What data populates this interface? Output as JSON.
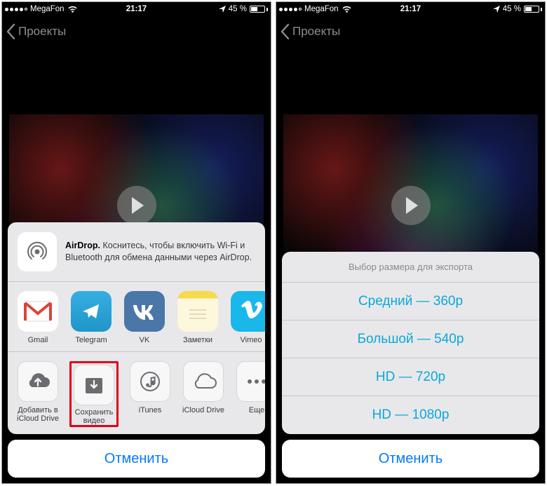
{
  "status": {
    "carrier": "MegaFon",
    "time": "21:17",
    "battery_text": "45 %",
    "battery_level": 45
  },
  "nav": {
    "back_label": "Проекты"
  },
  "phone1": {
    "airdrop_bold": "AirDrop.",
    "airdrop_text": " Коснитесь, чтобы включить Wi-Fi и Bluetooth для обмена данными через AirDrop.",
    "apps": [
      {
        "key": "gmail",
        "label": "Gmail"
      },
      {
        "key": "telegram",
        "label": "Telegram"
      },
      {
        "key": "vk",
        "label": "VK"
      },
      {
        "key": "notes",
        "label": "Заметки"
      },
      {
        "key": "vimeo",
        "label": "Vimeo"
      }
    ],
    "actions": [
      {
        "key": "icloud-add",
        "label": "Добавить в iCloud Drive"
      },
      {
        "key": "save-video",
        "label": "Сохранить видео",
        "highlight": true
      },
      {
        "key": "itunes",
        "label": "iTunes"
      },
      {
        "key": "icloud",
        "label": "iCloud Drive"
      },
      {
        "key": "more",
        "label": "Еще"
      }
    ],
    "cancel": "Отменить"
  },
  "phone2": {
    "header": "Выбор размера для экспорта",
    "options": [
      "Средний — 360p",
      "Большой — 540p",
      "HD — 720p",
      "HD — 1080p"
    ],
    "cancel": "Отменить"
  }
}
